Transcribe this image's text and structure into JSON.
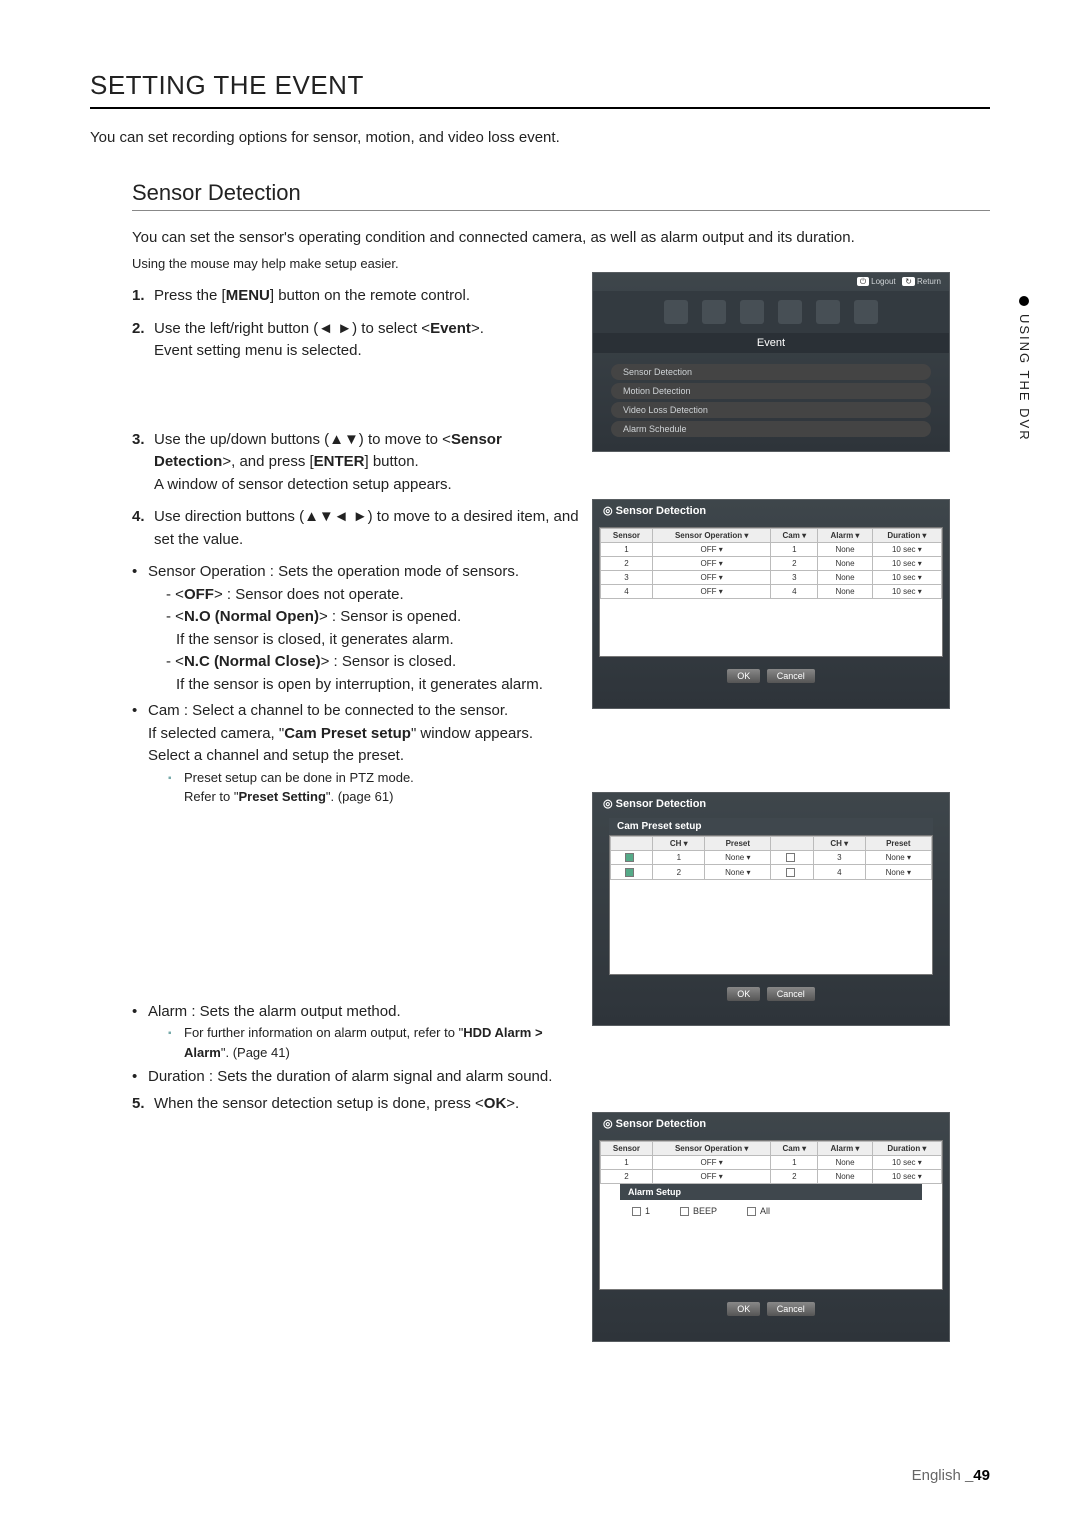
{
  "heading": "SETTING THE EVENT",
  "intro": "You can set recording options for sensor, motion, and video loss event.",
  "section": {
    "title": "Sensor Detection",
    "intro": "You can set the sensor's operating condition and connected camera, as well as alarm output and its duration.",
    "mouse_note": "Using the mouse may help make setup easier."
  },
  "step1": {
    "num": "1.",
    "a": "Press the [",
    "b": "MENU",
    "c": "] button on the remote control."
  },
  "step2": {
    "num": "2.",
    "a": "Use the left/right button (◄ ►) to select <",
    "b": "Event",
    "c1": ">.",
    "line2": "Event setting menu is selected."
  },
  "step3": {
    "num": "3.",
    "a": "Use the up/down buttons (▲▼) to move to <",
    "b": "Sensor Detection",
    "c": ">, and press [",
    "d": "ENTER",
    "e": "] button.",
    "line2": "A window of sensor detection setup appears."
  },
  "step4": {
    "num": "4.",
    "a": "Use direction buttons (▲▼◄ ►) to move to a desired item, and set the value."
  },
  "bullet_sensor_op": {
    "lead": "Sensor Operation : Sets the operation mode of sensors.",
    "off": {
      "a": "- <",
      "b": "OFF",
      "c": "> : Sensor does not operate."
    },
    "no": {
      "a": "- <",
      "b": "N.O (Normal Open)",
      "c": "> : Sensor is opened.",
      "line2": "If the sensor is closed, it generates alarm."
    },
    "nc": {
      "a": "- <",
      "b": "N.C (Normal Close)",
      "c": "> : Sensor is closed.",
      "line2": "If the sensor is open by interruption, it generates alarm."
    }
  },
  "bullet_cam": {
    "l1": "Cam : Select a channel to be connected to the sensor.",
    "l2a": "If selected camera, \"",
    "l2b": "Cam Preset setup",
    "l2c": "\" window appears.",
    "l3": "Select a channel and setup the preset.",
    "note": "Preset setup can be done in PTZ mode.",
    "ref_a": "Refer to \"",
    "ref_b": "Preset Setting",
    "ref_c": "\". (page 61)"
  },
  "bullet_alarm": {
    "l1": "Alarm : Sets the alarm output method.",
    "note_a": "For further information on alarm output, refer to \"",
    "note_b": "HDD Alarm > Alarm",
    "note_c": "\". (Page 41)"
  },
  "bullet_duration": "Duration : Sets the duration of alarm signal and alarm sound.",
  "step5": {
    "num": "5.",
    "a": "When the sensor detection setup is done, press <",
    "b": "OK",
    "c": ">."
  },
  "side_tab": "USING THE DVR",
  "footer_lang": "English ",
  "footer_page": "_49",
  "panels": {
    "event": {
      "top_right": {
        "logout": "Logout",
        "return": "Return"
      },
      "title": "Event",
      "items": [
        "Sensor Detection",
        "Motion Detection",
        "Video Loss Detection",
        "Alarm Schedule"
      ]
    },
    "sd_title": "Sensor Detection",
    "btn_ok": "OK",
    "btn_cancel": "Cancel",
    "sd_table": {
      "headers": [
        "Sensor",
        "Sensor Operation ▾",
        "Cam ▾",
        "Alarm ▾",
        "Duration ▾"
      ],
      "rows": [
        [
          "1",
          "OFF",
          "1",
          "None",
          "10 sec"
        ],
        [
          "2",
          "OFF",
          "2",
          "None",
          "10 sec"
        ],
        [
          "3",
          "OFF",
          "3",
          "None",
          "10 sec"
        ],
        [
          "4",
          "OFF",
          "4",
          "None",
          "10 sec"
        ]
      ]
    },
    "cam_preset": {
      "title": "Cam Preset setup",
      "headers": [
        "CH ▾",
        "Preset",
        "CH ▾",
        "Preset"
      ],
      "rows": [
        [
          "1",
          "None",
          "3",
          "None"
        ],
        [
          "2",
          "None",
          "4",
          "None"
        ]
      ],
      "check": [
        true,
        true,
        false,
        false
      ]
    },
    "alarm_setup": {
      "title": "Alarm Setup",
      "opts": [
        "1",
        "BEEP",
        "All"
      ]
    }
  }
}
